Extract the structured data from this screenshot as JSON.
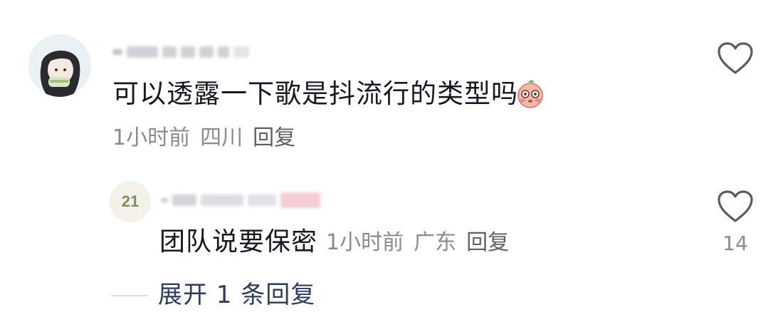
{
  "comment": {
    "text": "可以透露一下歌是抖流行的类型吗",
    "emoji": "blushing-face-emoji",
    "time": "1小时前",
    "location": "四川",
    "reply_label": "回复",
    "like_icon": "heart-outline-icon"
  },
  "reply": {
    "text": "团队说要保密",
    "time": "1小时前",
    "location": "广东",
    "reply_label": "回复",
    "like_icon": "heart-outline-icon",
    "like_count": "14",
    "avatar_text": "21"
  },
  "expand": {
    "label": "展开 1 条回复"
  },
  "colors": {
    "text": "#161823",
    "meta": "#8a8b91",
    "link": "#2f3b5a"
  }
}
